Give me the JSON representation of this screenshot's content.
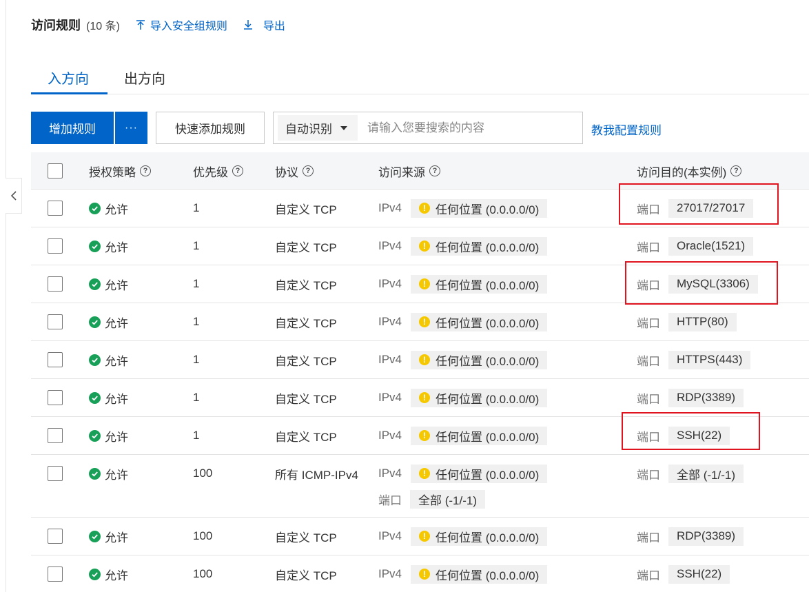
{
  "header": {
    "title": "访问规则",
    "count": "(10 条)",
    "import_label": "导入安全组规则",
    "export_label": "导出"
  },
  "tabs": [
    {
      "label": "入方向",
      "active": true
    },
    {
      "label": "出方向",
      "active": false
    }
  ],
  "toolbar": {
    "add_rule_label": "增加规则",
    "more_label": "···",
    "quick_add_label": "快速添加规则",
    "search_type": "自动识别",
    "search_placeholder": "请输入您要搜索的内容",
    "help_link": "教我配置规则"
  },
  "table": {
    "columns": [
      {
        "label": "授权策略",
        "help": true
      },
      {
        "label": "优先级",
        "help": true
      },
      {
        "label": "协议",
        "help": true
      },
      {
        "label": "访问来源",
        "help": true
      },
      {
        "label": "访问目的(本实例)",
        "help": true
      }
    ],
    "rows": [
      {
        "policy": "允许",
        "priority": "1",
        "protocol": "自定义 TCP",
        "ip": "IPv4",
        "source": "任何位置 (0.0.0.0/0)",
        "port_label": "端口",
        "port": "27017/27017"
      },
      {
        "policy": "允许",
        "priority": "1",
        "protocol": "自定义 TCP",
        "ip": "IPv4",
        "source": "任何位置 (0.0.0.0/0)",
        "port_label": "端口",
        "port": "Oracle(1521)"
      },
      {
        "policy": "允许",
        "priority": "1",
        "protocol": "自定义 TCP",
        "ip": "IPv4",
        "source": "任何位置 (0.0.0.0/0)",
        "port_label": "端口",
        "port": "MySQL(3306)"
      },
      {
        "policy": "允许",
        "priority": "1",
        "protocol": "自定义 TCP",
        "ip": "IPv4",
        "source": "任何位置 (0.0.0.0/0)",
        "port_label": "端口",
        "port": "HTTP(80)"
      },
      {
        "policy": "允许",
        "priority": "1",
        "protocol": "自定义 TCP",
        "ip": "IPv4",
        "source": "任何位置 (0.0.0.0/0)",
        "port_label": "端口",
        "port": "HTTPS(443)"
      },
      {
        "policy": "允许",
        "priority": "1",
        "protocol": "自定义 TCP",
        "ip": "IPv4",
        "source": "任何位置 (0.0.0.0/0)",
        "port_label": "端口",
        "port": "RDP(3389)"
      },
      {
        "policy": "允许",
        "priority": "1",
        "protocol": "自定义 TCP",
        "ip": "IPv4",
        "source": "任何位置 (0.0.0.0/0)",
        "port_label": "端口",
        "port": "SSH(22)"
      },
      {
        "policy": "允许",
        "priority": "100",
        "protocol": "所有 ICMP-IPv4",
        "ip": "IPv4",
        "source": "任何位置 (0.0.0.0/0)",
        "source_port_label": "端口",
        "source_port": "全部 (-1/-1)",
        "port_label": "端口",
        "port": "全部 (-1/-1)"
      },
      {
        "policy": "允许",
        "priority": "100",
        "protocol": "自定义 TCP",
        "ip": "IPv4",
        "source": "任何位置 (0.0.0.0/0)",
        "port_label": "端口",
        "port": "RDP(3389)"
      },
      {
        "policy": "允许",
        "priority": "100",
        "protocol": "自定义 TCP",
        "ip": "IPv4",
        "source": "任何位置 (0.0.0.0/0)",
        "port_label": "端口",
        "port": "SSH(22)"
      }
    ]
  },
  "colors": {
    "primary": "#0064c8",
    "allow": "#18a058",
    "warning": "#f5c800",
    "highlight": "#e0141e"
  }
}
